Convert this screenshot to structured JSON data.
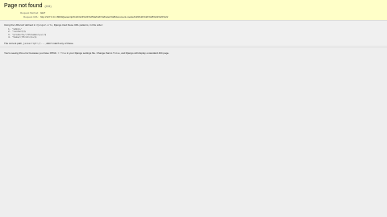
{
  "summary": {
    "title": "Page not found",
    "status": "(404)",
    "request_method_label": "Request Method:",
    "request_method": "GET",
    "request_url_label": "Request URL:",
    "request_url": "http://127.0.0.1:8000/javascript%3A%2F%2F%250a%2F%2Falert%28document.cookie%29%2F%2F%28%22%2F%22"
  },
  "info": {
    "intro_pre": "Using the URLconf defined in",
    "urlconf": "django2.urls",
    "intro_post": ", Django tried these URL patterns, in this order:",
    "patterns": [
      "^admin/",
      "^contact/$",
      "^products/(?P<name>\\w+)/$",
      "^home/(?P<id>\\d+)$"
    ],
    "path_pre": "The current path,",
    "current_path": "javascript://...",
    "path_post": ", didn't match any of these."
  },
  "explanation": {
    "text_1": "You're seeing this error because you have",
    "code_1": "DEBUG = True",
    "text_2": "in your Django settings file. Change that to",
    "code_2": "False",
    "text_3": ", and Django will display a standard 404 page."
  }
}
